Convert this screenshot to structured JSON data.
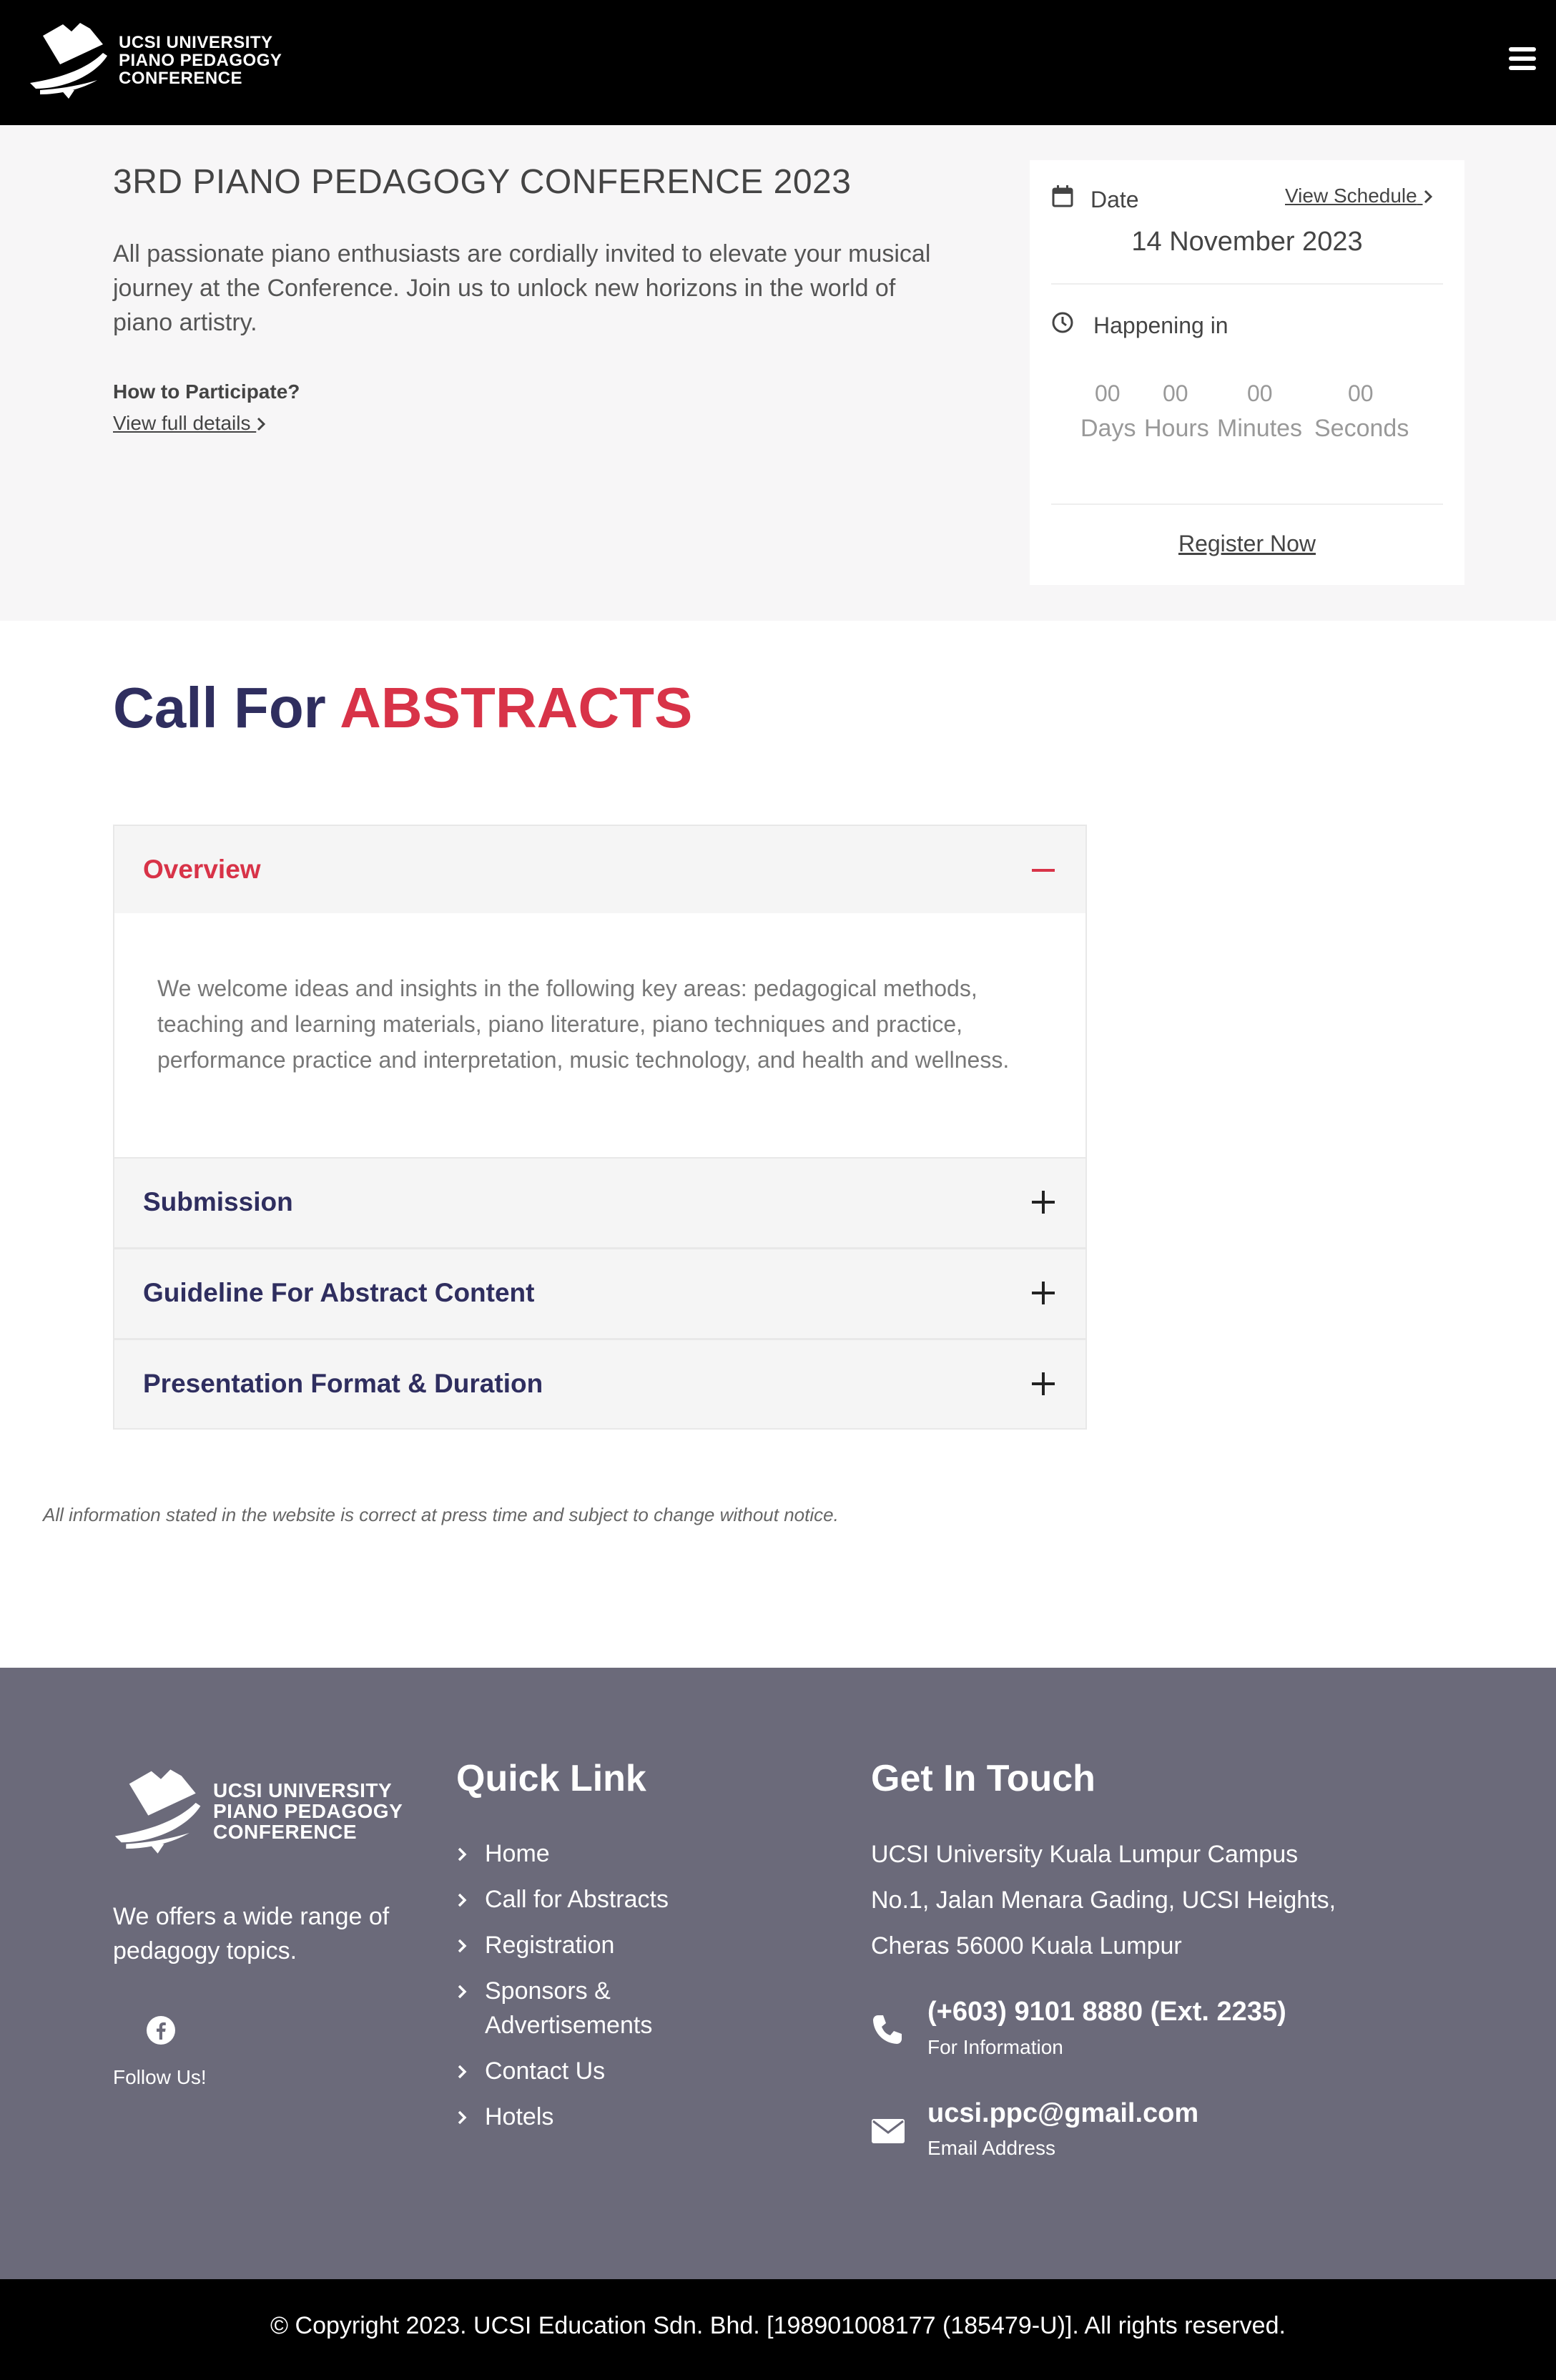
{
  "brand": {
    "logo_lines": [
      "UCSI UNIVERSITY",
      "PIANO PEDAGOGY",
      "CONFERENCE"
    ],
    "colors": {
      "navy": "#2f2e5f",
      "accent_red": "#d83348",
      "footer_bg": "#6b6a7a"
    }
  },
  "header": {
    "menu_icon": "hamburger-menu-icon"
  },
  "hero": {
    "title": "3RD PIANO PEDAGOGY CONFERENCE 2023",
    "description": "All passionate piano enthusiasts are cordially invited to elevate your musical journey at the Conference. Join us to unlock new horizons in the world of piano artistry.",
    "participate_label": "How to Participate?",
    "details_link": "View full details"
  },
  "event_card": {
    "date_label": "Date",
    "schedule_link": "View Schedule",
    "date_value": "14 November 2023",
    "happening_label": "Happening in",
    "countdown": [
      {
        "value": "00",
        "unit": "Days"
      },
      {
        "value": "00",
        "unit": "Hours"
      },
      {
        "value": "00",
        "unit": "Minutes"
      },
      {
        "value": "00",
        "unit": "Seconds"
      }
    ],
    "register_button": "Register Now"
  },
  "call_for_abstracts": {
    "heading_prefix": "Call For",
    "heading_accent": "ABSTRACTS",
    "accordion": [
      {
        "title": "Overview",
        "expanded": true,
        "body": "We welcome ideas and insights in the following key areas: pedagogical methods, teaching and learning materials, piano literature, piano techniques and practice, performance practice and interpretation, music technology, and health and wellness."
      },
      {
        "title": "Submission",
        "expanded": false
      },
      {
        "title": "Guideline For Abstract Content",
        "expanded": false
      },
      {
        "title": "Presentation Format & Duration",
        "expanded": false
      }
    ]
  },
  "disclaimer": "All information stated in the website is correct at press time and subject to change without notice.",
  "footer": {
    "tagline": "We offers a wide range of pedagogy topics.",
    "follow_label": "Follow Us!",
    "quick_link_heading": "Quick Link",
    "quick_links": [
      "Home",
      "Call for Abstracts",
      "Registration",
      "Sponsors & Advertisements",
      "Contact Us",
      "Hotels"
    ],
    "contact_heading": "Get In Touch",
    "address_lines": [
      "UCSI University Kuala Lumpur Campus",
      "No.1, Jalan Menara Gading, UCSI Heights,",
      "Cheras 56000 Kuala Lumpur"
    ],
    "phone": {
      "value": "(+603) 9101 8880 (Ext. 2235)",
      "label": "For Information"
    },
    "email": {
      "value": "ucsi.ppc@gmail.com",
      "label": "Email Address"
    },
    "copyright": "© Copyright 2023. UCSI Education Sdn. Bhd. [198901008177 (185479-U)]. All rights reserved."
  }
}
